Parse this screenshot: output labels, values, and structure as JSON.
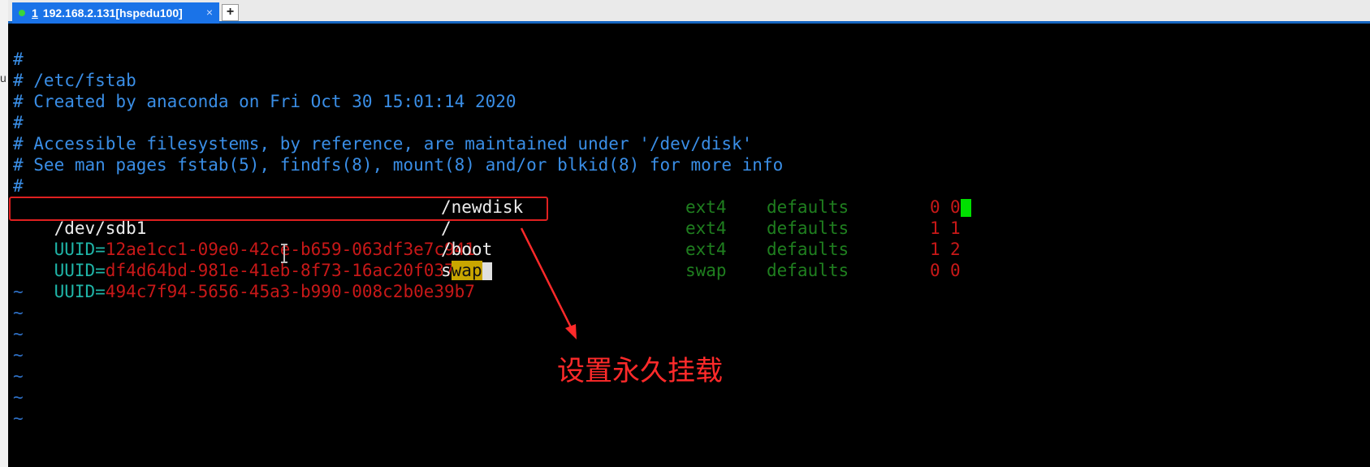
{
  "window": {
    "tab_number": "1",
    "tab_title": "192.168.2.131[hspedu100]",
    "tab_close": "×",
    "new_tab": "+",
    "left_fragment": "u"
  },
  "terminal": {
    "comments": [
      "#",
      "# /etc/fstab",
      "# Created by anaconda on Fri Oct 30 15:01:14 2020",
      "#",
      "# Accessible filesystems, by reference, are maintained under '/dev/disk'",
      "# See man pages fstab(5), findfs(8), mount(8) and/or blkid(8) for more info",
      "#"
    ],
    "entries": [
      {
        "device_prefix": "",
        "device": "/dev/sdb1",
        "mount": "/newdisk",
        "fstype": "ext4",
        "options": "defaults",
        "dump": "0",
        "pass": "0"
      },
      {
        "device_prefix": "UUID=",
        "device": "12ae1cc1-09e0-42ce-b659-063df3e7c941",
        "mount": "/",
        "fstype": "ext4",
        "options": "defaults",
        "dump": "1",
        "pass": "1"
      },
      {
        "device_prefix": "UUID=",
        "device": "df4d64bd-981e-41eb-8f73-16ac20f0371e",
        "mount": "/boot",
        "fstype": "ext4",
        "options": "defaults",
        "dump": "1",
        "pass": "2"
      },
      {
        "device_prefix": "UUID=",
        "device": "494c7f94-5656-45a3-b990-008c2b0e39b7",
        "mount_first": "s",
        "mount_rest": "wap",
        "fstype": "swap",
        "options": "defaults",
        "dump": "0",
        "pass": "0"
      }
    ],
    "tildes": [
      "~",
      "~",
      "~",
      "~",
      "~",
      "~",
      "~"
    ]
  },
  "annotation": {
    "text": "设置永久挂载",
    "color": "#ff2a2a"
  },
  "colors": {
    "accent": "#1a73e8",
    "comment": "#3a8ee6",
    "uuid_label": "#1fb5a8",
    "uuid_value": "#c81818",
    "fstype": "#1f7f1f",
    "highlight": "#c9a600",
    "cursor": "#00e000"
  }
}
